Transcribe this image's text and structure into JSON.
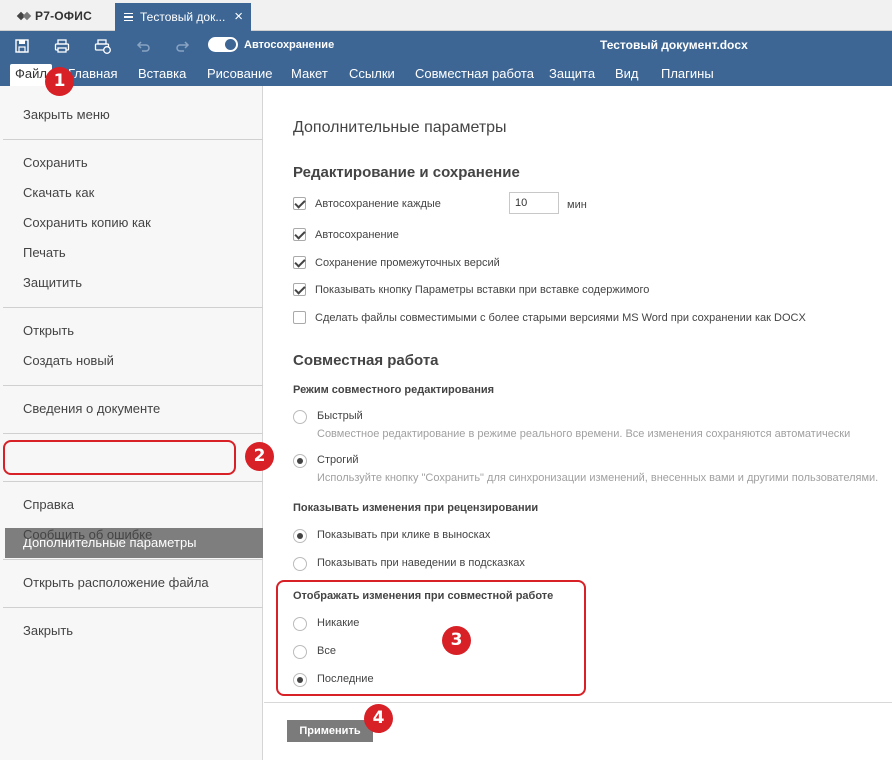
{
  "app": {
    "logo": "Р7-ОФИС",
    "tab_title": "Тестовый док..."
  },
  "header": {
    "autosave_label": "Автосохранение",
    "doc_title": "Тестовый документ.docx",
    "menu": [
      "Файл",
      "Главная",
      "Вставка",
      "Рисование",
      "Макет",
      "Ссылки",
      "Совместная работа",
      "Защита",
      "Вид",
      "Плагины"
    ]
  },
  "left_menu": {
    "close_menu": "Закрыть меню",
    "save": "Сохранить",
    "download_as": "Скачать как",
    "save_copy_as": "Сохранить копию как",
    "print": "Печать",
    "protect": "Защитить",
    "open": "Открыть",
    "create_new": "Создать новый",
    "doc_info": "Сведения о документе",
    "advanced_settings": "Дополнительные параметры",
    "help": "Справка",
    "report_error": "Сообщить об ошибке",
    "open_location": "Открыть расположение файла",
    "close": "Закрыть"
  },
  "settings": {
    "title": "Дополнительные параметры",
    "editing": {
      "heading": "Редактирование и сохранение",
      "autosave_every": "Автосохранение каждые",
      "autosave_minutes": "10",
      "minutes_unit": "мин",
      "autosave": "Автосохранение",
      "save_versions": "Сохранение промежуточных версий",
      "show_paste_button": "Показывать кнопку Параметры вставки при вставке содержимого",
      "compat_docx": "Сделать файлы совместимыми с более старыми версиями MS Word при сохранении как DOCX"
    },
    "collab": {
      "heading": "Совместная работа",
      "mode_heading": "Режим совместного редактирования",
      "fast": "Быстрый",
      "fast_desc": "Совместное редактирование в режиме реального времени. Все изменения сохраняются автоматически",
      "strict": "Строгий",
      "strict_desc": "Используйте кнопку \"Сохранить\" для синхронизации изменений, внесенных вами и другими пользователями.",
      "review_heading": "Показывать изменения при рецензировании",
      "show_on_click": "Показывать при клике в выносках",
      "show_on_hover": "Показывать при наведении в подсказках",
      "display_heading": "Отображать изменения при совместной работе",
      "none": "Никакие",
      "all": "Все",
      "last": "Последние"
    },
    "apply": "Применить"
  },
  "annotations": {
    "b1": "1",
    "b2": "2",
    "b3": "3",
    "b4": "4",
    "color": "#d82027"
  },
  "colors": {
    "accent": "#3d6694",
    "active_menu": "#7e7e7e"
  }
}
